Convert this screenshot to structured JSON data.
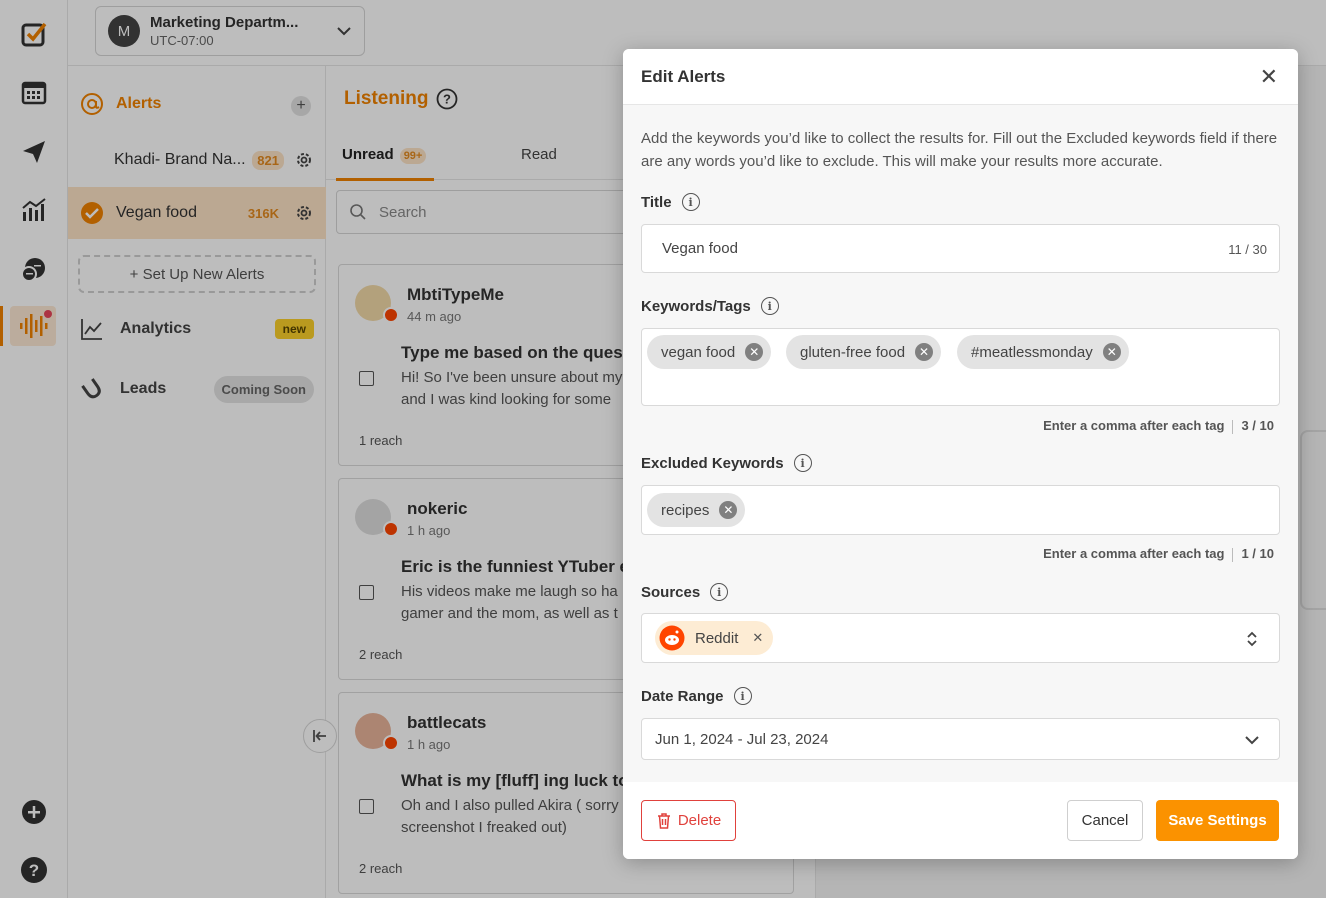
{
  "workspace": {
    "avatar": "M",
    "name": "Marketing Departm...",
    "timezone": "UTC-07:00"
  },
  "rail": {
    "icons": [
      "checkbox-logo-icon",
      "calendar-icon",
      "send-icon",
      "analytics-bars-icon",
      "chat-icon",
      "listening-waves-icon",
      "plus-circle-icon",
      "help-icon"
    ]
  },
  "sidebar": {
    "alerts_label": "Alerts",
    "alerts": [
      {
        "name": "Khadi- Brand Na...",
        "count": "821"
      },
      {
        "name": "Vegan food",
        "count": "316K"
      }
    ],
    "setup_label": "+ Set Up New Alerts",
    "nav": [
      {
        "label": "Analytics",
        "badge": "new"
      },
      {
        "label": "Leads",
        "badge": "Coming Soon"
      }
    ]
  },
  "feed": {
    "title": "Listening",
    "tabs": [
      {
        "label": "Unread",
        "badge": "99+"
      },
      {
        "label": "Read"
      }
    ],
    "search_placeholder": "Search",
    "posts": [
      {
        "user": "MbtiTypeMe",
        "time": "44 m ago",
        "headline": "Type me based on the ques",
        "body1": "Hi! So I've been unsure about my",
        "body2": "and I was kind looking for some",
        "reach": "1 reach"
      },
      {
        "user": "nokeric",
        "time": "1 h ago",
        "headline": "Eric is the funniest YTuber e",
        "body1": "His videos make me laugh so ha",
        "body2": "gamer and the mom, as well as t",
        "reach": "2 reach"
      },
      {
        "user": "battlecats",
        "time": "1 h ago",
        "headline": "What is my [fluff] ing luck to",
        "body1": "Oh and I also pulled Akira ( sorry",
        "body2": "screenshot I freaked out)",
        "reach": "2 reach"
      }
    ]
  },
  "modal": {
    "title": "Edit Alerts",
    "description": "Add the keywords you’d like to collect the results for. Fill out the Excluded keywords field if there are any words you’d like to exclude. This will make your results more accurate.",
    "title_field": {
      "label": "Title",
      "value": "Vegan food",
      "counter": "11 / 30"
    },
    "keywords": {
      "label": "Keywords/Tags",
      "tags": [
        "vegan food",
        "gluten-free food",
        "#meatlessmonday"
      ],
      "hint": "Enter a comma after each tag",
      "count": "3 / 10"
    },
    "excluded": {
      "label": "Excluded Keywords",
      "tags": [
        "recipes"
      ],
      "hint": "Enter a comma after each tag",
      "count": "1 / 10"
    },
    "sources": {
      "label": "Sources",
      "selected": "Reddit"
    },
    "date_range": {
      "label": "Date Range",
      "value": "Jun 1, 2024 - Jul 23, 2024"
    },
    "buttons": {
      "delete": "Delete",
      "cancel": "Cancel",
      "save": "Save Settings"
    }
  },
  "colors": {
    "accent": "#f08200",
    "save": "#fb9200",
    "danger": "#e0413c",
    "reddit": "#ff4500"
  }
}
